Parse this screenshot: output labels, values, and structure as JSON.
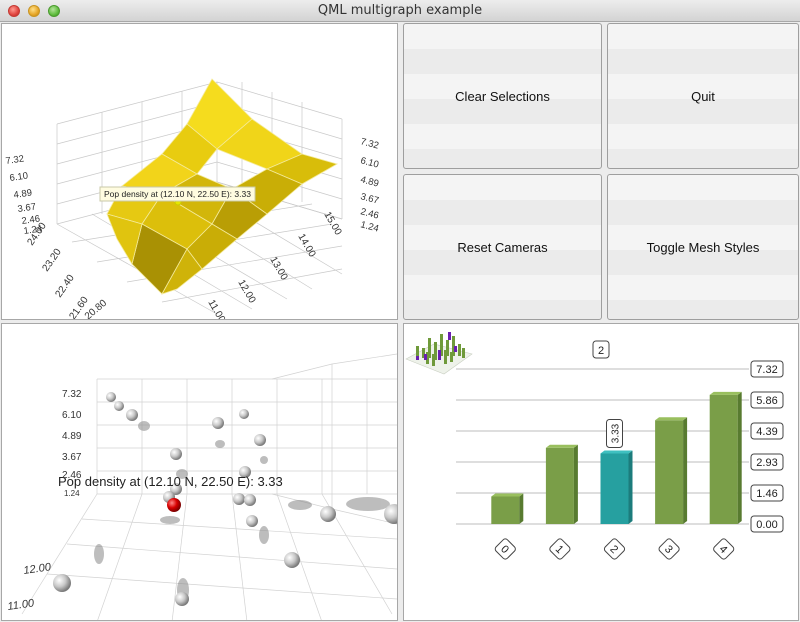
{
  "window": {
    "title": "QML multigraph example"
  },
  "buttons": {
    "clear_selections": "Clear Selections",
    "quit": "Quit",
    "reset_cameras": "Reset Cameras",
    "toggle_mesh_styles": "Toggle Mesh Styles"
  },
  "surface": {
    "y_ticks": [
      "7.32",
      "6.10",
      "4.89",
      "3.67",
      "2.46",
      "1.24"
    ],
    "right_ticks": [
      "7.32",
      "6.10",
      "4.89",
      "3.67",
      "2.46",
      "1.24"
    ],
    "lat_ticks": [
      "24.00",
      "23.20",
      "22.40",
      "21.60",
      "20.80"
    ],
    "lon_ticks": [
      "15.00",
      "14.00",
      "13.00",
      "12.00",
      "11.00"
    ],
    "tooltip": "Pop density at (12.10 N, 22.50 E): 3.33",
    "color": "#e8c800"
  },
  "scatter": {
    "y_ticks": [
      "7.32",
      "6.10",
      "4.89",
      "3.67",
      "2.46",
      "1.24"
    ],
    "lon_ticks": [
      "12.00",
      "11.00"
    ],
    "tooltip": "Pop density at (12.10 N, 22.50 E): 3.33",
    "selected_color": "#d60000"
  },
  "bars": {
    "slice_label": "2",
    "value_ticks": [
      "7.32",
      "5.86",
      "4.39",
      "2.93",
      "1.46",
      "0.00"
    ],
    "selected_value_label": "3.33",
    "bar_color": "#7a9e48",
    "selected_color": "#26a0a0"
  },
  "chart_data": {
    "type": "bar",
    "categories": [
      "0",
      "1",
      "2",
      "3",
      "4"
    ],
    "values": [
      1.3,
      3.6,
      3.33,
      4.9,
      6.1
    ],
    "selected_index": 2,
    "ylim": [
      0,
      7.32
    ],
    "title": "2"
  }
}
